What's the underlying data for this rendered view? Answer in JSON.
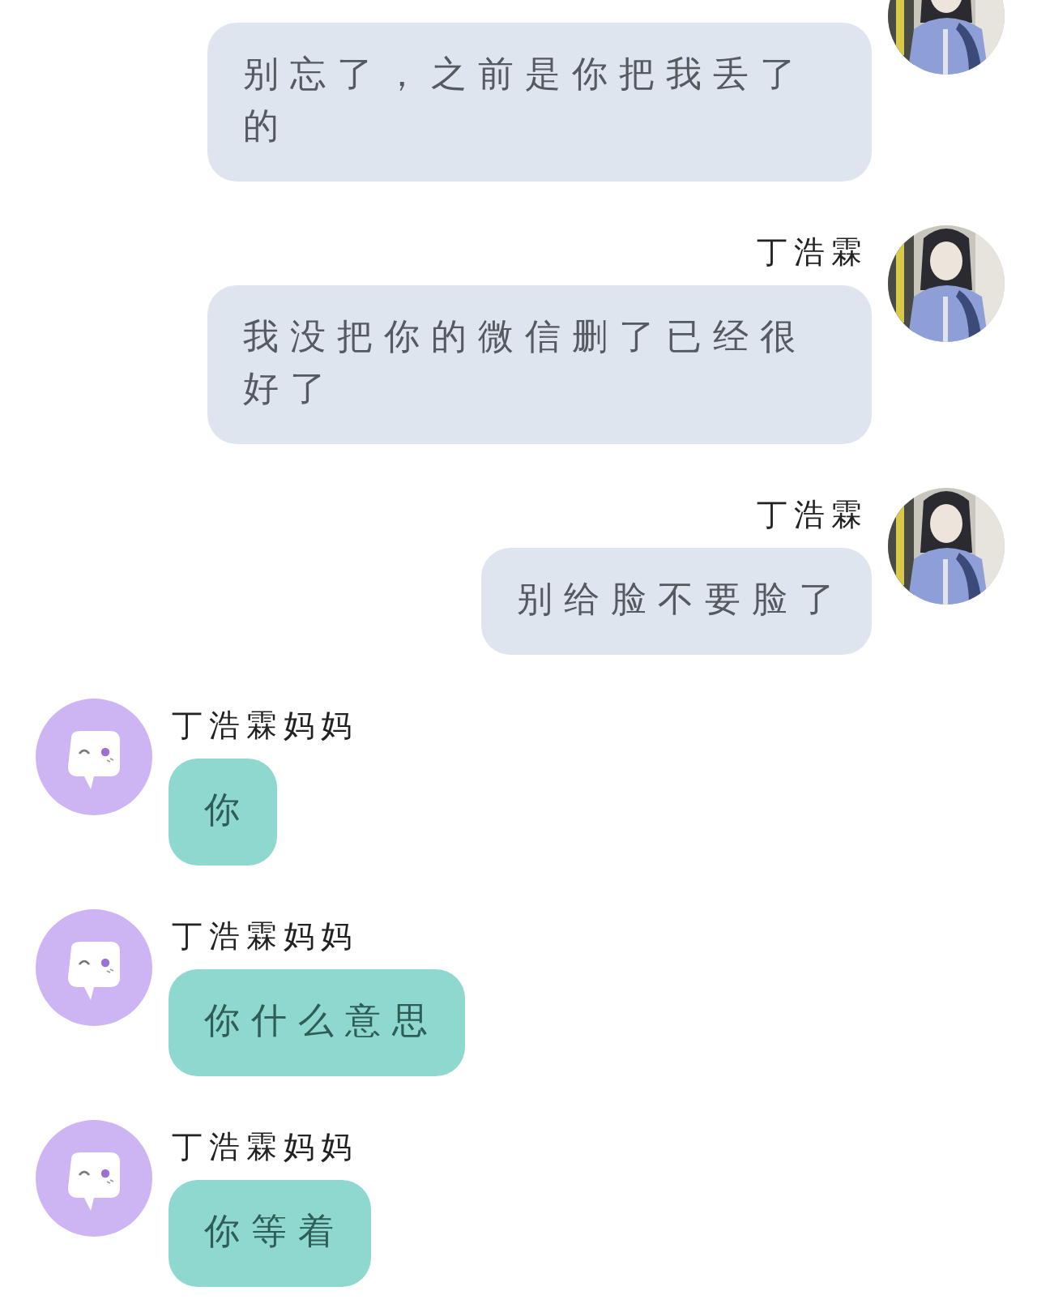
{
  "messages": [
    {
      "kind": "outgoing",
      "text": "别忘了，之前是你把我丢了的"
    },
    {
      "kind": "outgoing",
      "sender": "丁浩霖",
      "text": "我没把你的微信删了已经很好了"
    },
    {
      "kind": "outgoing",
      "sender": "丁浩霖",
      "text": "别给脸不要脸了"
    },
    {
      "kind": "incoming",
      "sender": "丁浩霖妈妈",
      "avatar": {
        "kind": "icon"
      },
      "text": "你"
    },
    {
      "kind": "incoming",
      "sender": "丁浩霖妈妈",
      "avatar": {
        "kind": "icon"
      },
      "text": "你什么意思"
    },
    {
      "kind": "incoming",
      "sender": "丁浩霖妈妈",
      "avatar": {
        "kind": "icon"
      },
      "text": "你等着"
    }
  ]
}
